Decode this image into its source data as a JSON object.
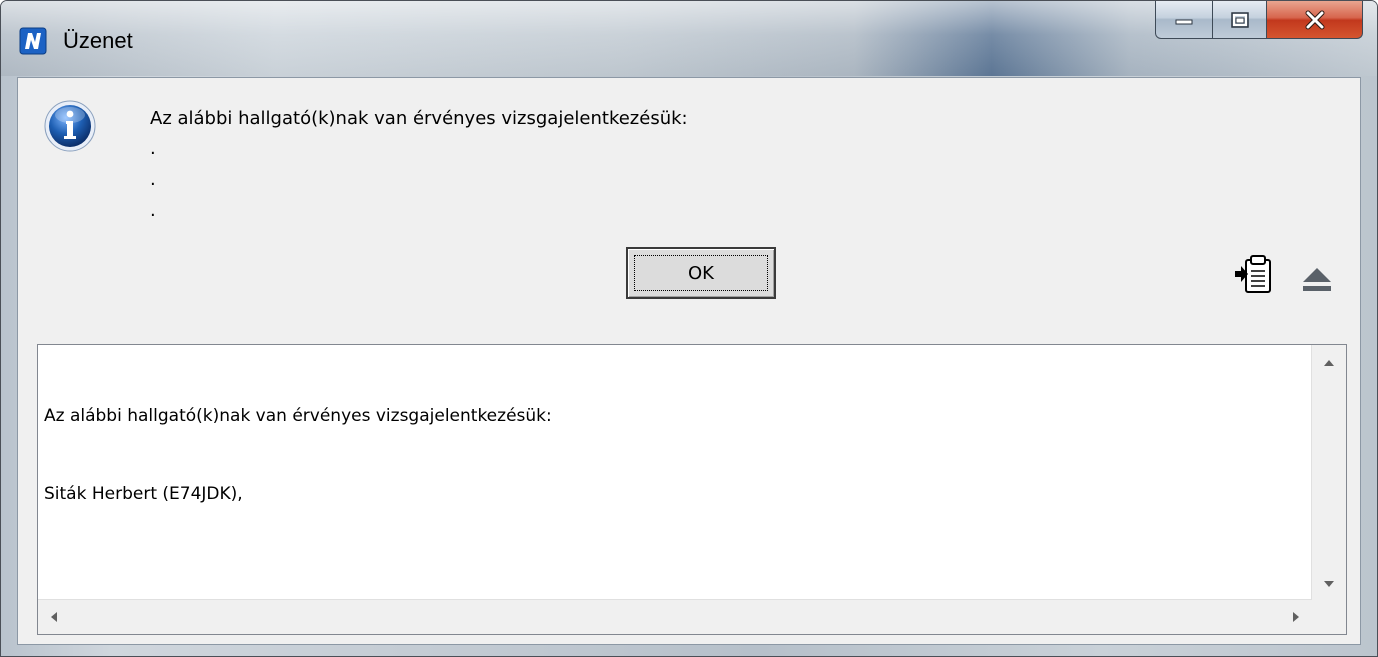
{
  "window": {
    "title": "Üzenet",
    "app_icon": "app-logo-icon",
    "controls": {
      "minimize_icon": "minimize-icon",
      "maximize_icon": "maximize-icon",
      "close_icon": "close-icon"
    }
  },
  "message": {
    "icon": "info-icon",
    "text": "Az alábbi hallgató(k)nak van érvényes vizsgajelentkezésük:",
    "dots": [
      ".",
      ".",
      "."
    ]
  },
  "buttons": {
    "ok_label": "OK",
    "copy_icon": "copy-to-clipboard-icon",
    "toggle_details_icon": "eject-collapse-icon"
  },
  "details": {
    "lines": [
      "Az alábbi hallgató(k)nak van érvényes vizsgajelentkezésük:",
      "Siták Herbert (E74JDK),"
    ]
  },
  "colors": {
    "close_button": "#c2381d",
    "info_icon_blue": "#1e5fb3"
  }
}
